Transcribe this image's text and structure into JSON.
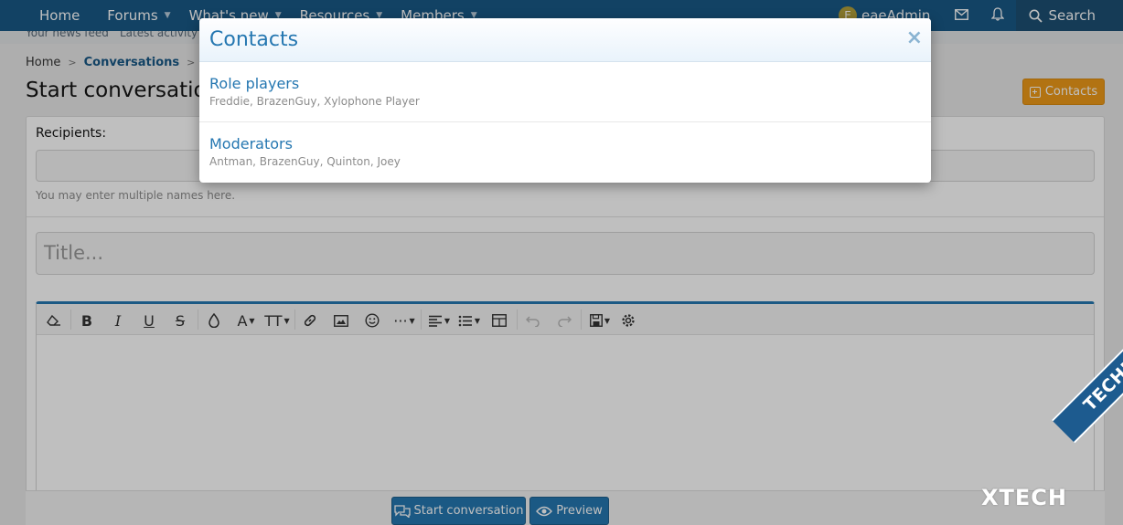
{
  "nav": {
    "home": "Home",
    "forums": "Forums",
    "whats_new": "What's new",
    "resources": "Resources",
    "members": "Members",
    "avatar_letter": "E",
    "username": "eaeAdmin",
    "search": "Search"
  },
  "subnav": {
    "news_feed": "Your news feed",
    "latest_activity": "Latest activity"
  },
  "breadcrumb": {
    "home": "Home",
    "conversations": "Conversations"
  },
  "page": {
    "title": "Start conversation",
    "contacts_button": "Contacts"
  },
  "form": {
    "recipients_label": "Recipients:",
    "recipients_hint": "You may enter multiple names here.",
    "title_placeholder": "Title..."
  },
  "buttons": {
    "start_conversation": "Start conversation",
    "preview": "Preview"
  },
  "modal": {
    "title": "Contacts",
    "close": "×",
    "groups": [
      {
        "name": "Role players",
        "members": "Freddie, BrazenGuy, Xylophone Player"
      },
      {
        "name": "Moderators",
        "members": "Antman, BrazenGuy, Quinton, Joey"
      }
    ]
  },
  "watermark": {
    "band": "TECHIESHOME.COM",
    "text": "XTECH"
  },
  "colors": {
    "nav_bg": "#185886",
    "link_blue": "#2577b1",
    "contacts_orange": "#ee9a19"
  }
}
